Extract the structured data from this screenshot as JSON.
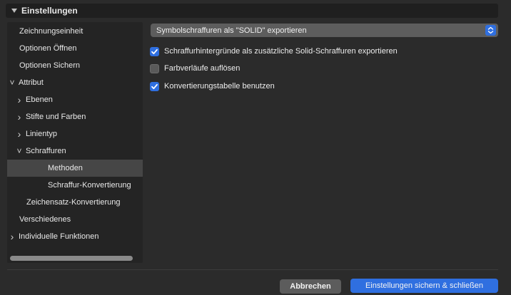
{
  "header": {
    "title": "Einstellungen"
  },
  "tree": {
    "items": [
      {
        "label": "Zeichnungseinheit",
        "indent": 0,
        "chevron": "none",
        "selected": false
      },
      {
        "label": "Optionen Öffnen",
        "indent": 0,
        "chevron": "none",
        "selected": false
      },
      {
        "label": "Optionen Sichern",
        "indent": 0,
        "chevron": "none",
        "selected": false
      },
      {
        "label": "Attribut",
        "indent": 0,
        "chevron": "down",
        "selected": false
      },
      {
        "label": "Ebenen",
        "indent": 1,
        "chevron": "right",
        "selected": false
      },
      {
        "label": "Stifte und Farben",
        "indent": 1,
        "chevron": "right",
        "selected": false
      },
      {
        "label": "Linientyp",
        "indent": 1,
        "chevron": "right",
        "selected": false
      },
      {
        "label": "Schraffuren",
        "indent": 1,
        "chevron": "down",
        "selected": false
      },
      {
        "label": "Methoden",
        "indent": 2,
        "chevron": "none",
        "selected": true
      },
      {
        "label": "Schraffur-Konvertierung",
        "indent": 2,
        "chevron": "none",
        "selected": false
      },
      {
        "label": "Zeichensatz-Konvertierung",
        "indent": 1,
        "chevron": "none",
        "selected": false
      },
      {
        "label": "Verschiedenes",
        "indent": 0,
        "chevron": "none",
        "selected": false
      },
      {
        "label": "Individuelle Funktionen",
        "indent": 0,
        "chevron": "right",
        "selected": false
      }
    ]
  },
  "select": {
    "value": "Symbolschraffuren als \"SOLID\" exportieren"
  },
  "options": [
    {
      "label": "Schraffurhintergründe als zusätzliche Solid-Schraffuren exportieren",
      "checked": true
    },
    {
      "label": "Farbverläufe auflösen",
      "checked": false
    },
    {
      "label": "Konvertierungstabelle benutzen",
      "checked": true
    }
  ],
  "buttons": {
    "cancel": "Abbrechen",
    "save": "Einstellungen sichern & schließen"
  },
  "colors": {
    "accent": "#2f6fe0",
    "background": "#2b2b2b",
    "selection": "#464646"
  }
}
